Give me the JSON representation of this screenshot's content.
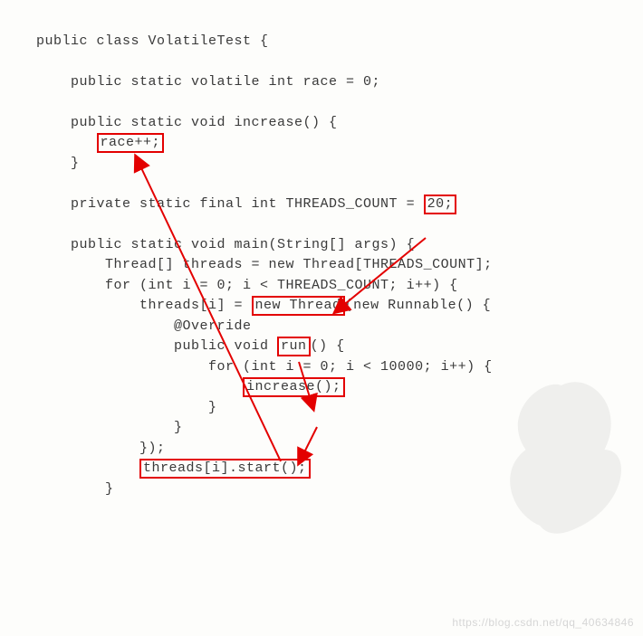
{
  "code": {
    "l1": "public class VolatileTest {",
    "l2": "",
    "l3": "    public static volatile int race = 0;",
    "l4": "",
    "l5": "    public static void increase() {",
    "l6_pre": "       ",
    "l6_box": "race++;",
    "l7": "    }",
    "l8": "",
    "l9_pre": "    private static final int THREADS_COUNT = ",
    "l9_box": "20;",
    "l10": "",
    "l11": "    public static void main(String[] args) {",
    "l12": "        Thread[] threads = new Thread[THREADS_COUNT];",
    "l13": "        for (int i = 0; i < THREADS_COUNT; i++) {",
    "l14_pre": "            threads[i] = ",
    "l14_box": "new Thread",
    "l14_post": "(new Runnable() {",
    "l15": "                @Override",
    "l16_pre": "                public void ",
    "l16_box": "run",
    "l16_post": "() {",
    "l17": "                    for (int i = 0; i < 10000; i++) {",
    "l18_pre": "                        ",
    "l18_box": "increase();",
    "l19": "                    }",
    "l20": "                }",
    "l21": "            });",
    "l22_pre": "            ",
    "l22_box": "threads[i].start();",
    "l23": "        }"
  },
  "watermark": "https://blog.csdn.net/qq_40634846"
}
